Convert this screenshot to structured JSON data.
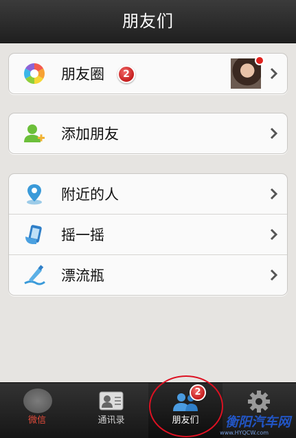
{
  "header": {
    "title": "朋友们"
  },
  "groups": [
    {
      "items": [
        {
          "label": "朋友圈",
          "icon": "camera-aperture-icon",
          "badge": "2",
          "has_avatar": true
        }
      ]
    },
    {
      "items": [
        {
          "label": "添加朋友",
          "icon": "add-user-icon"
        }
      ]
    },
    {
      "items": [
        {
          "label": "附近的人",
          "icon": "location-pin-icon"
        },
        {
          "label": "摇一摇",
          "icon": "shake-phone-icon"
        },
        {
          "label": "漂流瓶",
          "icon": "drift-bottle-icon"
        }
      ]
    }
  ],
  "tabbar": {
    "tabs": [
      {
        "label": "微信",
        "icon": "chat-icon"
      },
      {
        "label": "通讯录",
        "icon": "contacts-card-icon"
      },
      {
        "label": "朋友们",
        "icon": "friends-icon",
        "badge": "2",
        "active": true
      },
      {
        "label": "",
        "icon": "gear-icon"
      }
    ]
  },
  "watermark": {
    "text": "衡阳汽车网",
    "url_text": "www.HYQCW.com"
  },
  "colors": {
    "header_bg": "#2b2b2b",
    "badge_red": "#d32a2a",
    "background": "#e6e4e1",
    "watermark_blue": "#2255c4"
  }
}
